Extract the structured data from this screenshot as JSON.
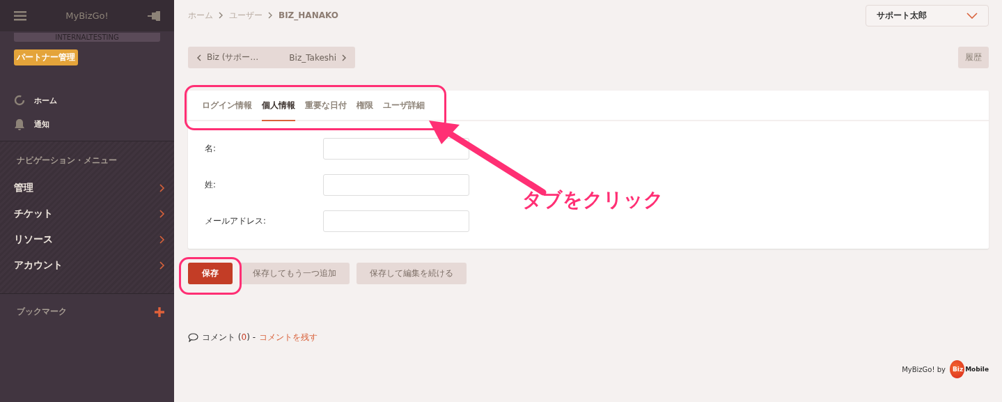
{
  "sidebar": {
    "title": "MyBizGo!",
    "environment": "INTERNALTESTING",
    "badge": "パートナー管理",
    "quick_items": [
      {
        "label": "ホーム",
        "kind": "home"
      },
      {
        "label": "通知",
        "kind": "bell"
      }
    ],
    "nav_heading": "ナビゲーション・メニュー",
    "nav_items": [
      {
        "label": "管理"
      },
      {
        "label": "チケット"
      },
      {
        "label": "リソース"
      },
      {
        "label": "アカウント"
      }
    ],
    "bookmarks_heading": "ブックマーク"
  },
  "breadcrumb": [
    {
      "label": "ホーム",
      "current": false
    },
    {
      "label": "ユーザー",
      "current": false
    },
    {
      "label": "BIZ_HANAKO",
      "current": true
    }
  ],
  "user_menu": "サポート太郎",
  "pager": {
    "previous": "Biz (サポー…",
    "next": "Biz_Takeshi"
  },
  "history_button": "履歴",
  "tabs": [
    {
      "label": "ログイン情報",
      "selected": false
    },
    {
      "label": "個人情報",
      "selected": true
    },
    {
      "label": "重要な日付",
      "selected": false
    },
    {
      "label": "権限",
      "selected": false
    },
    {
      "label": "ユーザ詳細",
      "selected": false
    }
  ],
  "fields": [
    {
      "label": "名:"
    },
    {
      "label": "姓:"
    },
    {
      "label": "メールアドレス:"
    }
  ],
  "buttons": [
    {
      "label": "保存",
      "kind": "primary"
    },
    {
      "label": "保存してもう一つ追加",
      "kind": "secondary"
    },
    {
      "label": "保存して編集を続ける",
      "kind": "secondary"
    }
  ],
  "comments": {
    "label": "コメント (",
    "count": "0",
    "after": ") -",
    "link": "コメントを残す"
  },
  "footer": {
    "text": "MyBizGo! by",
    "logo_mark": "Biz",
    "logo_text": "Mobile"
  },
  "annotation": {
    "text": "タブをクリック"
  }
}
